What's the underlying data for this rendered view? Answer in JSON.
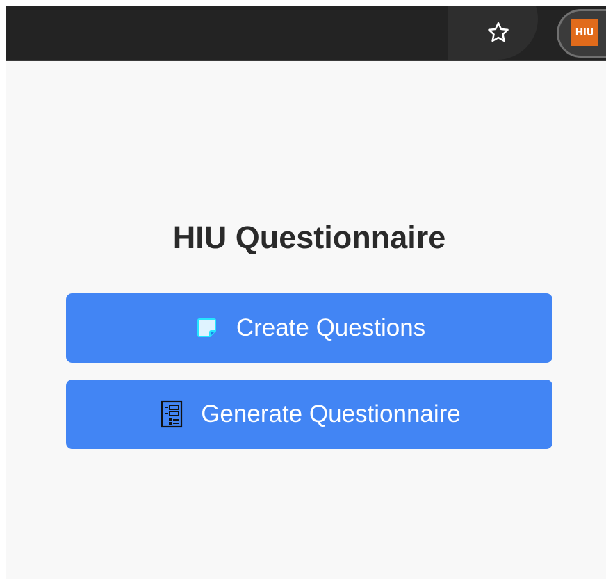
{
  "browser": {
    "bookmark_icon": "star-outline-icon",
    "extension": {
      "label": "HIU",
      "color": "#e16b1b"
    }
  },
  "main": {
    "title": "HIU Questionnaire",
    "buttons": [
      {
        "label": "Create Questions",
        "icon": "sticky-note-icon"
      },
      {
        "label": "Generate Questionnaire",
        "icon": "form-list-icon"
      }
    ]
  },
  "colors": {
    "primary_button": "#4285f4",
    "toolbar": "#232323",
    "background": "#f8f8f8"
  }
}
